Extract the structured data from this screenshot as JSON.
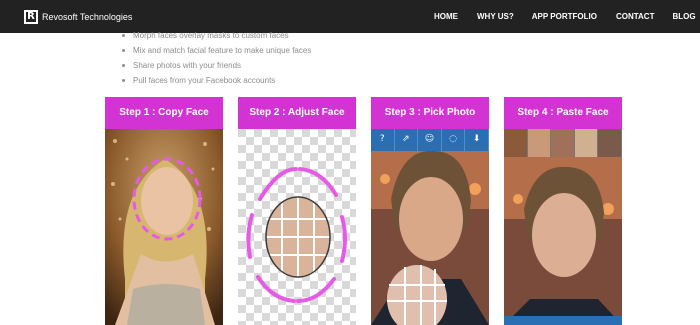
{
  "brand": {
    "name": "Revosoft Technologies",
    "logo_letter": "R"
  },
  "nav": {
    "home": "HOME",
    "why": "WHY US?",
    "apps": "APP PORTFOLIO",
    "contact": "CONTACT",
    "blog": "BLOG"
  },
  "features": [
    "Morph faces overlay masks to custom faces",
    "Mix and match facial feature to make unique faces",
    "Share photos with your friends",
    "Pull faces from your Facebook accounts"
  ],
  "steps": [
    {
      "title": "Step 1 : Copy Face"
    },
    {
      "title": "Step 2 : Adjust Face"
    },
    {
      "title": "Step 3 : Pick Photo"
    },
    {
      "title": "Step 4 : Paste Face"
    }
  ],
  "colors": {
    "navbar": "#222222",
    "step_header": "#d233d2",
    "toolbar": "#2a6fb3",
    "feature_text": "#8d8d8d"
  },
  "icons": [
    "question-icon",
    "export-icon",
    "face-icon",
    "crop-icon",
    "download-icon"
  ]
}
